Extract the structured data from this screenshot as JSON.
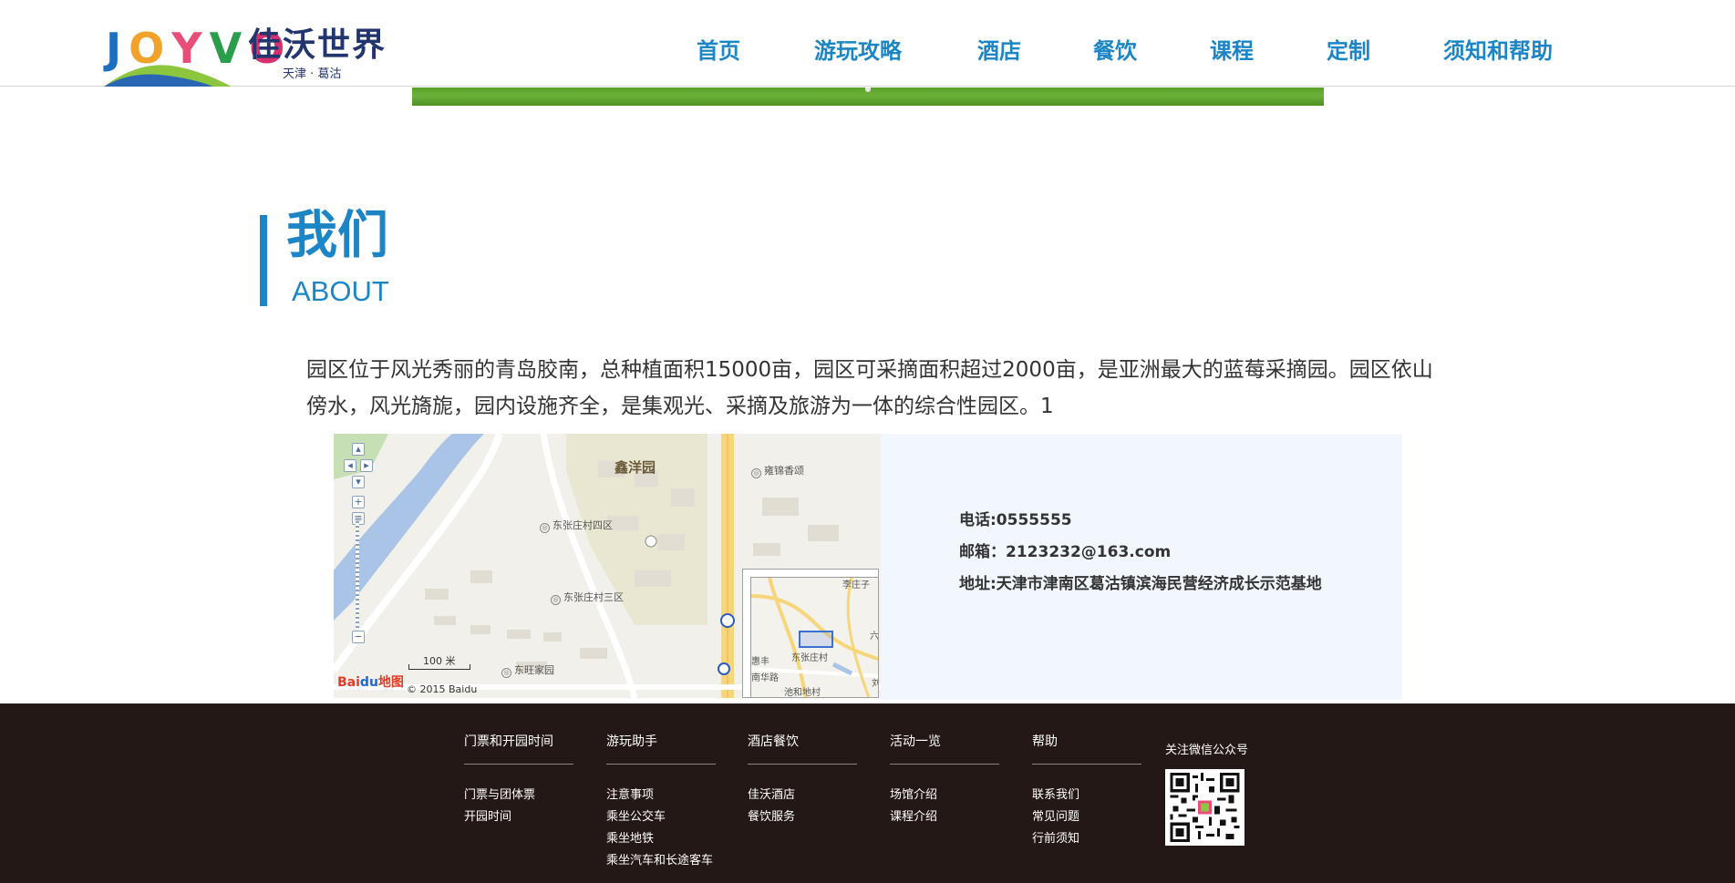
{
  "header": {
    "logo_letters": [
      "J",
      "O",
      "Y",
      "V",
      "O"
    ],
    "logo_name": "佳沃世界",
    "logo_sub": "天津 · 葛沽",
    "nav": [
      {
        "label": "首页"
      },
      {
        "label": "游玩攻略"
      },
      {
        "label": "酒店"
      },
      {
        "label": "餐饮"
      },
      {
        "label": "课程"
      },
      {
        "label": "定制"
      },
      {
        "label": "须知和帮助"
      }
    ]
  },
  "about": {
    "title": "我们",
    "subtitle": "ABOUT",
    "text": "园区位于风光秀丽的青岛胶南，总种植面积15000亩，园区可采摘面积超过2000亩，是亚洲最大的蓝莓采摘园。园区依山傍水，风光旖旎，园内设施齐全，是集观光、采摘及旅游为一体的综合性园区。1"
  },
  "map": {
    "labels": {
      "xinyang": "鑫洋园",
      "yongjin": "雍锦香颂",
      "dzz4": "东张庄村四区",
      "dzz3": "东张庄村三区",
      "dongwang": "东旺家园"
    },
    "zoom_in": "+",
    "zoom_out": "−",
    "scale": "100 米",
    "brand": "Bai",
    "brand_mid": "du",
    "brand_tail": "地图",
    "copyright": "© 2015 Baidu",
    "overview_labels": {
      "lizhuangzi": "李庄子",
      "six": "六",
      "huifeng": "惠丰",
      "dzz": "东张庄村",
      "nanhua": "南华路",
      "chihe": "池和地村",
      "liu": "刘"
    }
  },
  "contact": {
    "phone": "电话:0555555",
    "email": "邮箱：2123232@163.com",
    "address": "地址:天津市津南区葛沽镇滨海民营经济成长示范基地"
  },
  "footer": {
    "columns": [
      {
        "title": "门票和开园时间",
        "links": [
          "门票与团体票",
          "开园时间"
        ]
      },
      {
        "title": "游玩助手",
        "links": [
          "注意事项",
          "乘坐公交车",
          "乘坐地铁",
          "乘坐汽车和长途客车"
        ]
      },
      {
        "title": "酒店餐饮",
        "links": [
          "佳沃酒店",
          "餐饮服务"
        ]
      },
      {
        "title": "活动一览",
        "links": [
          "场馆介绍",
          "课程介绍"
        ]
      },
      {
        "title": "帮助",
        "links": [
          "联系我们",
          "常见问题",
          "行前须知"
        ]
      }
    ],
    "qr_title": "关注微信公众号"
  },
  "colors": {
    "brand_blue": "#1b85c6",
    "footer_bg": "#231815",
    "contact_bg": "#f1f7fd"
  }
}
